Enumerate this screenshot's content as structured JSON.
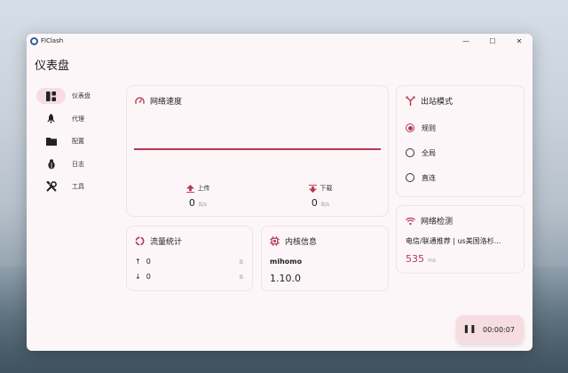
{
  "window": {
    "app_name": "FlClash",
    "minimize": "—",
    "maximize": "☐",
    "close": "✕"
  },
  "page_title": "仪表盘",
  "sidebar": {
    "items": [
      {
        "label": "仪表盘",
        "icon": "dashboard-icon",
        "active": true
      },
      {
        "label": "代理",
        "icon": "rocket-icon"
      },
      {
        "label": "配置",
        "icon": "folder-icon"
      },
      {
        "label": "日志",
        "icon": "bug-icon"
      },
      {
        "label": "工具",
        "icon": "tools-icon"
      }
    ]
  },
  "network_speed": {
    "title": "网络速度",
    "upload_label": "上传",
    "upload_value": "0",
    "upload_unit": "B/s",
    "download_label": "下载",
    "download_value": "0",
    "download_unit": "B/s"
  },
  "traffic": {
    "title": "流量统计",
    "up_value": "0",
    "up_unit": "B",
    "down_value": "0",
    "down_unit": "B"
  },
  "core": {
    "title": "内核信息",
    "name": "mihomo",
    "version": "1.10.0"
  },
  "outbound": {
    "title": "出站模式",
    "options": [
      "规则",
      "全局",
      "直连"
    ],
    "selected": "规则"
  },
  "network_check": {
    "title": "网络检测",
    "location": "电信/联通推荐 | us美国洛杉...",
    "latency": "535",
    "latency_unit": "ms"
  },
  "timer": {
    "elapsed": "00:00:07"
  },
  "colors": {
    "accent": "#b33a52",
    "accent_soft": "#f5dde2"
  }
}
